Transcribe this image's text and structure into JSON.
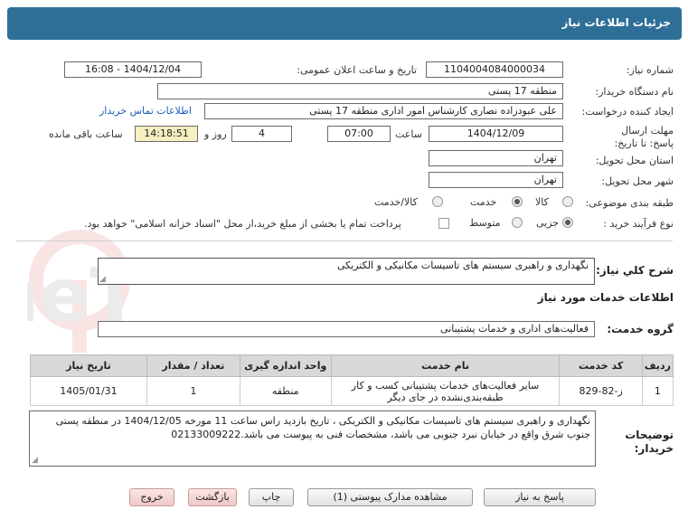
{
  "header": {
    "title": "جزئیات اطلاعات نیاز"
  },
  "fields": {
    "need_number_label": "شماره نیاز:",
    "need_number": "1104004084000034",
    "announce_label": "تاریخ و ساعت اعلان عمومی:",
    "announce_value": "1404/12/04 - 16:08",
    "buyer_org_label": "نام دستگاه خریدار:",
    "buyer_org": "منطقه 17 پستی",
    "creator_label": "ایجاد کننده درخواست:",
    "creator": "علی عبودزاده نصاری کارشناس امور اداری منطقه 17 پستی",
    "contact_link": "اطلاعات تماس خریدار",
    "deadline_label": "مهلت ارسال پاسخ: تا تاریخ:",
    "deadline_date": "1404/12/09",
    "time_label": "ساعت",
    "deadline_time": "07:00",
    "days_value": "4",
    "days_label": "روز و",
    "remaining_time": "14:18:51",
    "remaining_label": "ساعت باقی مانده",
    "province_label": "استان محل تحویل:",
    "province": "تهران",
    "city_label": "شهر محل تحویل:",
    "city": "تهران",
    "category_label": "طبقه بندی موضوعی:",
    "category_options": [
      "کالا",
      "خدمت",
      "کالا/خدمت"
    ],
    "category_selected": "خدمت",
    "process_label": "نوع فرآیند خرید :",
    "process_options": [
      "جزیی",
      "متوسط"
    ],
    "process_selected": "جزیی",
    "payment_note": "پرداخت تمام یا بخشی از مبلغ خرید،از محل \"اسناد خزانه اسلامی\" خواهد بود."
  },
  "summary": {
    "label": "شرح کلي نياز:",
    "value": "نگهداری و راهبری سیستم های تاسیسات مکانیکی و الکتریکی"
  },
  "services": {
    "section_title": "اطلاعات خدمات مورد نیاز",
    "group_label": "گروه خدمت:",
    "group_value": "فعالیت‌های اداری و خدمات پشتیبانی",
    "columns": [
      "ردیف",
      "کد خدمت",
      "نام خدمت",
      "واحد اندازه گیری",
      "تعداد / مقدار",
      "تاریخ نیاز"
    ],
    "rows": [
      {
        "index": "1",
        "code": "ز-82-829",
        "name": "سایر فعالیت‌های خدمات پشتیبانی کسب و کار طبقه‌بندی‌نشده در جای دیگر",
        "unit": "منطقه",
        "qty": "1",
        "date": "1405/01/31"
      }
    ]
  },
  "notes": {
    "label": "توضیحات خریدار:",
    "value": "نگهداری و راهبری سیستم های تاسیسات مکانیکی و الکتریکی ، تاریخ بازدید راس ساعت 11 مورخه 1404/12/05  در منطقه پستی جنوب شرق واقع در خیابان نبرد جنوبی می باشد، مشخصات فنی به پیوست می باشد.02133009222"
  },
  "buttons": {
    "reply": "پاسخ به نیاز",
    "attachments": "مشاهده مدارک پیوستی (1)",
    "print": "چاپ",
    "back": "بازگشت",
    "exit": "خروج"
  },
  "watermark": {
    "text": "AriaTender.neT"
  },
  "colors": {
    "header_bg": "#2e6f97",
    "remaining_bg": "#f6efc0",
    "link": "#1c5fb8"
  }
}
